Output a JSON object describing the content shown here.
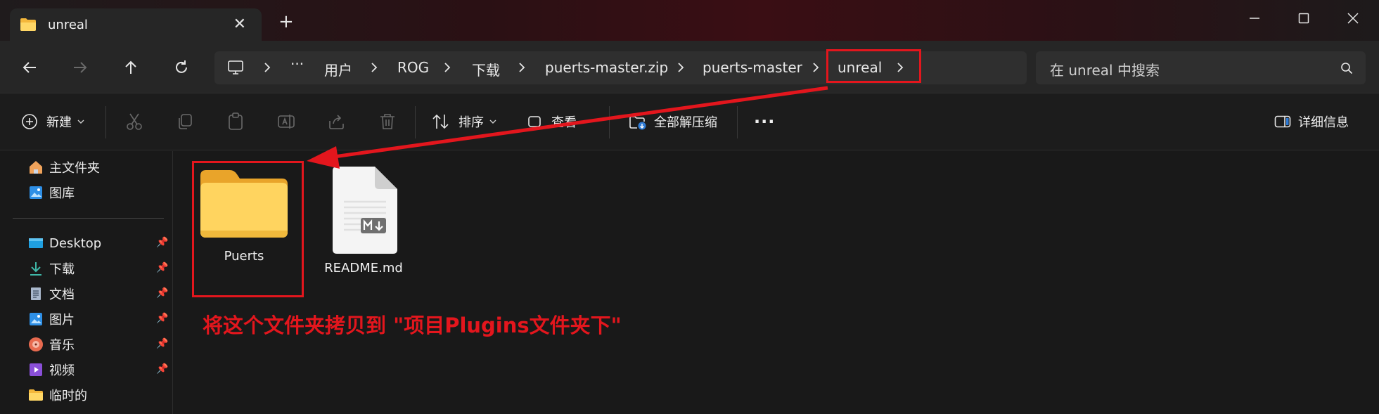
{
  "window": {
    "tab_title": "unreal",
    "tab_icon": "folder-icon",
    "new_tab_label": "+",
    "controls": [
      "minimize-icon",
      "maximize-icon",
      "close-icon"
    ]
  },
  "address": {
    "crumbs": [
      "用户",
      "ROG",
      "下载",
      "puerts-master.zip",
      "puerts-master",
      "unreal"
    ],
    "ellipsis": "···",
    "search_placeholder": "在 unreal 中搜索"
  },
  "toolbar": {
    "new_label": "新建",
    "sort_label": "排序",
    "view_label": "查看",
    "extract_all_label": "全部解压缩",
    "more_label": "···",
    "details_label": "详细信息"
  },
  "sidebar": {
    "quick": [
      {
        "label": "主文件夹",
        "icon": "home-icon"
      },
      {
        "label": "图库",
        "icon": "gallery-icon"
      }
    ],
    "pinned": [
      {
        "label": "Desktop",
        "icon": "desktop-icon",
        "pinned": true
      },
      {
        "label": "下载",
        "icon": "download-icon",
        "pinned": true
      },
      {
        "label": "文档",
        "icon": "document-icon",
        "pinned": true
      },
      {
        "label": "图片",
        "icon": "pictures-icon",
        "pinned": true
      },
      {
        "label": "音乐",
        "icon": "music-icon",
        "pinned": true
      },
      {
        "label": "视频",
        "icon": "video-icon",
        "pinned": true
      },
      {
        "label": "临时的",
        "icon": "folder-icon",
        "pinned": false
      }
    ]
  },
  "files": [
    {
      "name": "Puerts",
      "type": "folder"
    },
    {
      "name": "README.md",
      "type": "markdown"
    }
  ],
  "annotation": {
    "text": "将这个文件夹拷贝到 \"项目Plugins文件夹下\"",
    "color": "#e3161d"
  }
}
